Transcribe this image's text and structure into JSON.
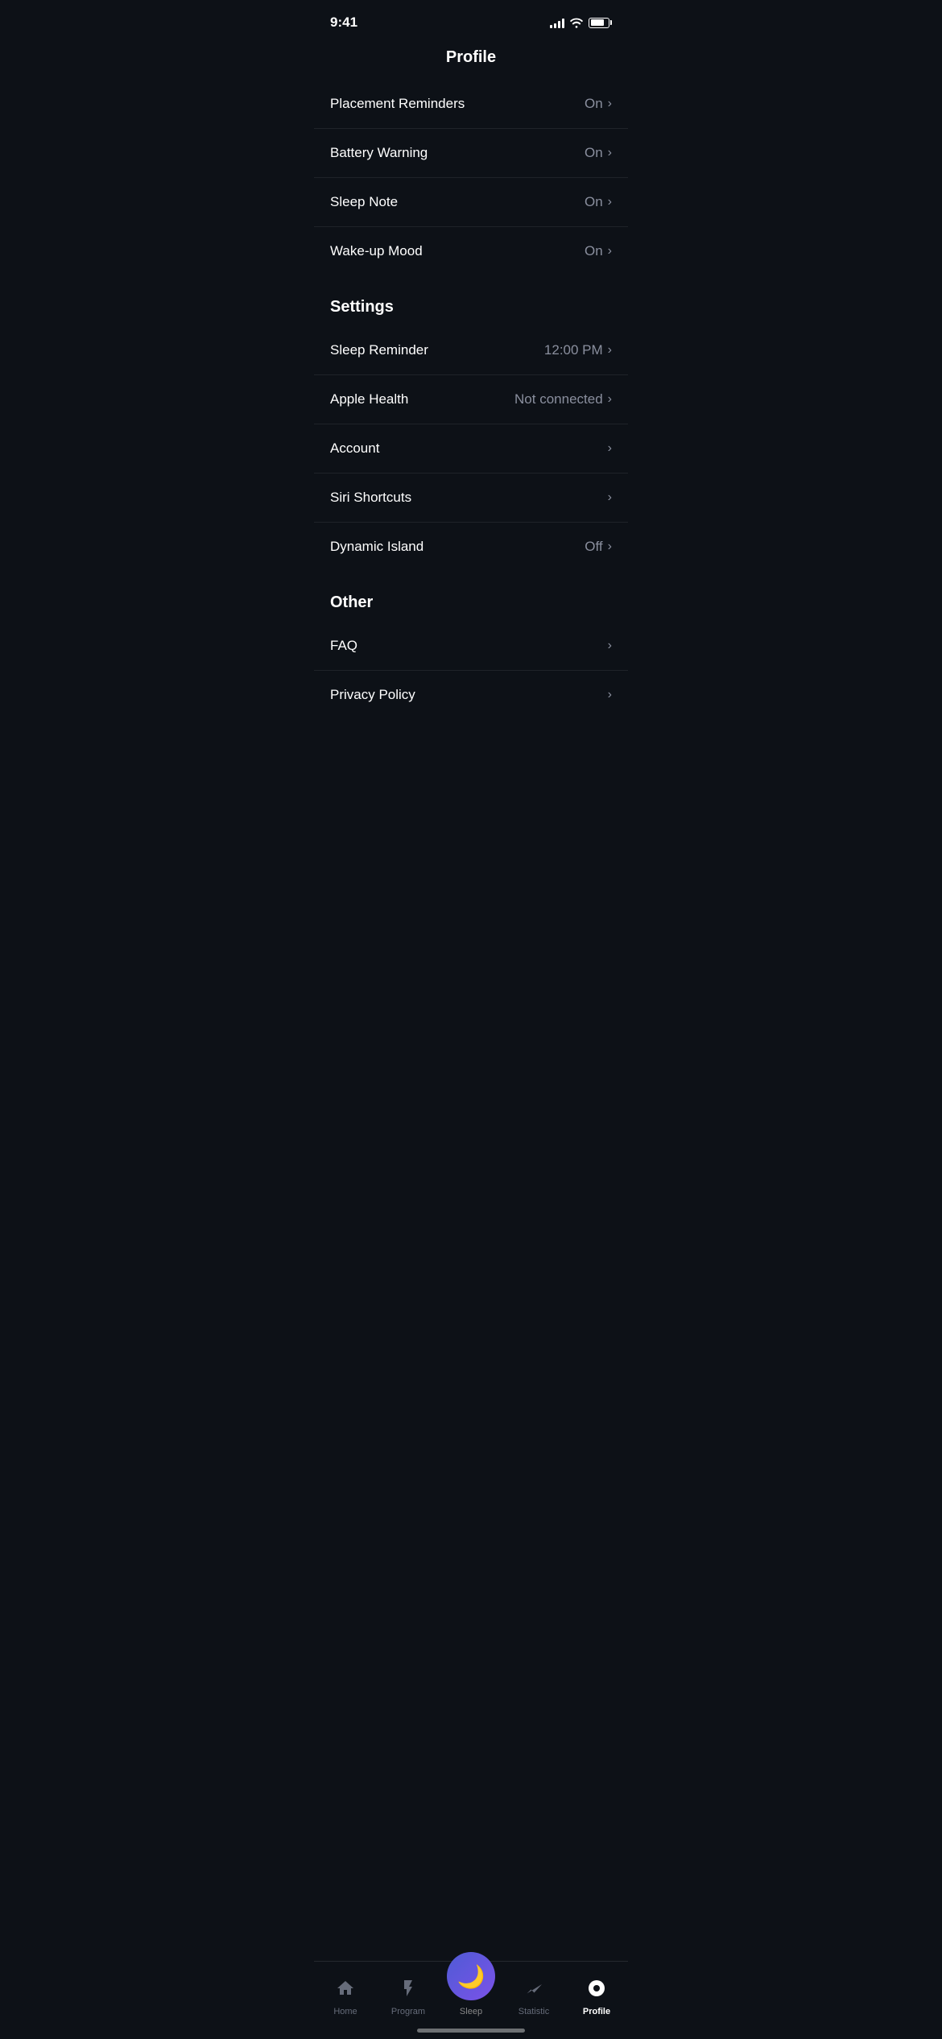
{
  "statusBar": {
    "time": "9:41"
  },
  "pageTitle": "Profile",
  "notificationSection": {
    "items": [
      {
        "label": "Placement Reminders",
        "value": "On",
        "hasChevron": true
      },
      {
        "label": "Battery Warning",
        "value": "On",
        "hasChevron": true
      },
      {
        "label": "Sleep Note",
        "value": "On",
        "hasChevron": true
      },
      {
        "label": "Wake-up Mood",
        "value": "On",
        "hasChevron": true
      }
    ]
  },
  "settingsSection": {
    "header": "Settings",
    "items": [
      {
        "label": "Sleep Reminder",
        "value": "12:00 PM",
        "hasChevron": true
      },
      {
        "label": "Apple Health",
        "value": "Not connected",
        "hasChevron": true
      },
      {
        "label": "Account",
        "value": "",
        "hasChevron": true
      },
      {
        "label": "Siri Shortcuts",
        "value": "",
        "hasChevron": true
      },
      {
        "label": "Dynamic Island",
        "value": "Off",
        "hasChevron": true
      }
    ]
  },
  "otherSection": {
    "header": "Other",
    "items": [
      {
        "label": "FAQ",
        "value": "",
        "hasChevron": true
      },
      {
        "label": "Privacy Policy",
        "value": "",
        "hasChevron": true
      }
    ]
  },
  "tabBar": {
    "tabs": [
      {
        "id": "home",
        "label": "Home",
        "icon": "🏠",
        "active": false
      },
      {
        "id": "program",
        "label": "Program",
        "icon": "⚡",
        "active": false
      },
      {
        "id": "sleep",
        "label": "Sleep",
        "icon": "🌙",
        "active": false,
        "center": true
      },
      {
        "id": "statistic",
        "label": "Statistic",
        "icon": "📈",
        "active": false
      },
      {
        "id": "profile",
        "label": "Profile",
        "icon": "😶",
        "active": true
      }
    ]
  }
}
